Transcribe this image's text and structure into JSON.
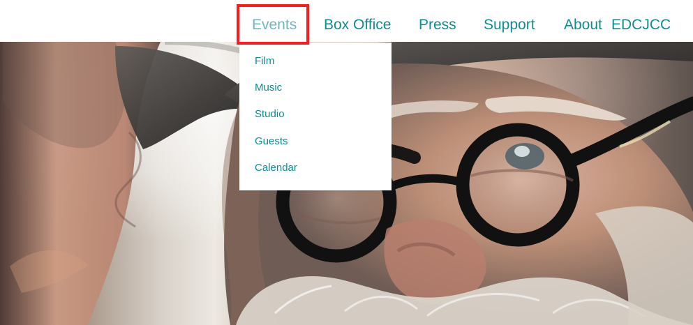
{
  "nav": {
    "items": [
      {
        "label": "Events",
        "active": true
      },
      {
        "label": "Box Office"
      },
      {
        "label": "Press"
      },
      {
        "label": "Support"
      },
      {
        "label": "About"
      },
      {
        "label": "EDCJCC"
      }
    ]
  },
  "dropdown": {
    "items": [
      {
        "label": "Film"
      },
      {
        "label": "Music"
      },
      {
        "label": "Studio"
      },
      {
        "label": "Guests"
      },
      {
        "label": "Calendar"
      }
    ]
  },
  "colors": {
    "link": "#0f8c93",
    "active_link": "#6fb7bf",
    "highlight": "#ff1b1b"
  }
}
